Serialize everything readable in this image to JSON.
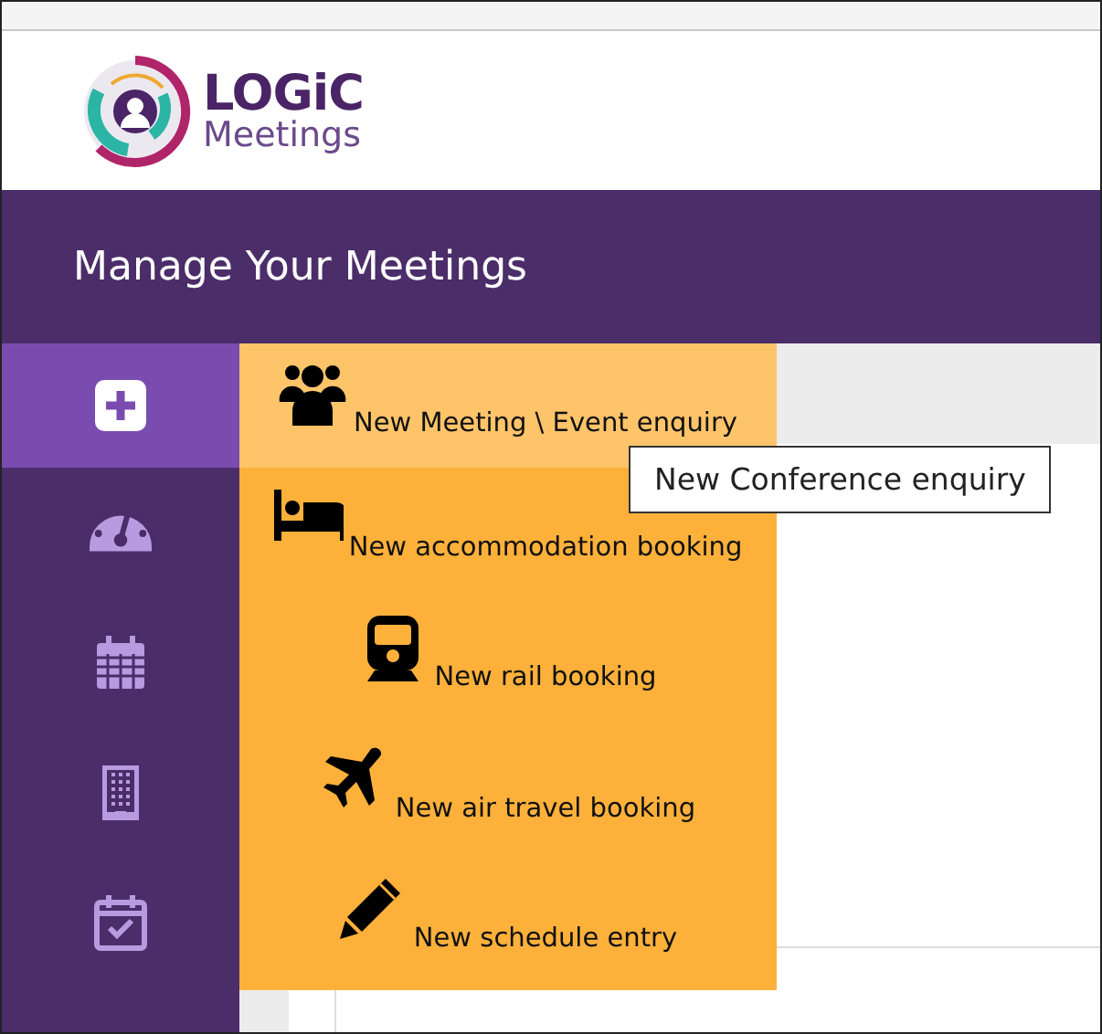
{
  "logo": {
    "brand": "LOGiC",
    "subtitle": "Meetings"
  },
  "header": {
    "title": "Manage Your Meetings"
  },
  "sidebar": {
    "items": [
      {
        "kind": "add",
        "selected": true
      },
      {
        "kind": "dashboard",
        "selected": false
      },
      {
        "kind": "calendar",
        "selected": false
      },
      {
        "kind": "building",
        "selected": false
      },
      {
        "kind": "schedule",
        "selected": false
      }
    ]
  },
  "menu": {
    "items": [
      {
        "kind": "group",
        "label": "New Meeting \\ Event enquiry",
        "selected": true
      },
      {
        "kind": "bed",
        "label": "New accommodation booking",
        "selected": false
      },
      {
        "kind": "train",
        "label": "New rail booking",
        "selected": false
      },
      {
        "kind": "plane",
        "label": "New air travel booking",
        "selected": false
      },
      {
        "kind": "pencil",
        "label": "New schedule entry",
        "selected": false
      }
    ]
  },
  "tooltip": {
    "text": "New Conference enquiry"
  }
}
